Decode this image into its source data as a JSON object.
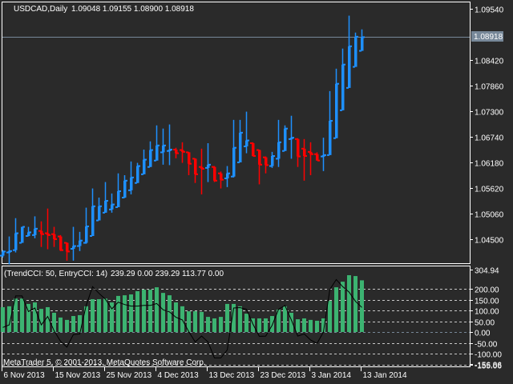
{
  "header": {
    "symbol": "USDCAD,Daily",
    "ohlc": "1.09048 1.09155 1.08900 1.08918"
  },
  "indicator": {
    "label": "(TrendCCI: 50, EntryCCI: 14)",
    "values": "239.29 0.00 239.29 113.77 0.00"
  },
  "copyright": "MetaTrader 5, © 2001-2013, MetaQuotes Software Corp.",
  "colors": {
    "background": "#2a2a2a",
    "up": "#1e90ff",
    "down": "#ff0000",
    "histogram": "#3cb371",
    "entry_line": "#000000",
    "price_line": "#778899"
  },
  "chart_data": [
    {
      "type": "ohlc",
      "title": "USDCAD,Daily",
      "current_price": "1.08918",
      "ylim": [
        1.0405,
        1.099
      ],
      "y_ticks": [
        "1.09540",
        "1.08420",
        "1.07860",
        "1.07300",
        "1.06740",
        "1.06180",
        "1.05620",
        "1.05060",
        "1.04500"
      ],
      "y_tick_values": [
        1.0954,
        1.0842,
        1.0786,
        1.073,
        1.0674,
        1.0618,
        1.0562,
        1.0506,
        1.045
      ],
      "x_labels": [
        {
          "bar": 0,
          "label": "6 Nov 2013"
        },
        {
          "bar": 8,
          "label": "15 Nov 2013"
        },
        {
          "bar": 16,
          "label": "25 Nov 2013"
        },
        {
          "bar": 24,
          "label": "4 Dec 2013"
        },
        {
          "bar": 32,
          "label": "13 Dec 2013"
        },
        {
          "bar": 40,
          "label": "23 Dec 2013"
        },
        {
          "bar": 48,
          "label": "3 Jan 2014"
        },
        {
          "bar": 56,
          "label": "13 Jan 2014"
        }
      ],
      "bars": [
        [
          1.0426,
          1.041,
          1.0423,
          1.0414,
          "u"
        ],
        [
          1.0456,
          1.0395,
          1.0424,
          1.0421,
          "u"
        ],
        [
          1.0496,
          1.0421,
          1.0463,
          1.0426,
          "u"
        ],
        [
          1.0477,
          1.0442,
          1.0477,
          1.0442,
          "u"
        ],
        [
          1.0477,
          1.0456,
          1.0465,
          1.0457,
          "u"
        ],
        [
          1.05,
          1.0452,
          1.0473,
          1.0459,
          "u"
        ],
        [
          1.0489,
          1.0433,
          1.0468,
          1.0461,
          "d"
        ],
        [
          1.0517,
          1.0428,
          1.0463,
          1.0459,
          "d"
        ],
        [
          1.0477,
          1.0433,
          1.0461,
          1.045,
          "d"
        ],
        [
          1.0459,
          1.0424,
          1.0456,
          1.0426,
          "d"
        ],
        [
          1.0443,
          1.0403,
          1.0442,
          1.0423,
          "d"
        ],
        [
          1.0477,
          1.0403,
          1.0435,
          1.0429,
          "u"
        ],
        [
          1.0466,
          1.0424,
          1.0447,
          1.0435,
          "u"
        ],
        [
          1.0519,
          1.044,
          1.0478,
          1.0442,
          "u"
        ],
        [
          1.0561,
          1.0457,
          1.0522,
          1.0457,
          "u"
        ],
        [
          1.0541,
          1.0491,
          1.0522,
          1.0491,
          "u"
        ],
        [
          1.0575,
          1.0508,
          1.0534,
          1.0508,
          "u"
        ],
        [
          1.055,
          1.0508,
          1.0526,
          1.0515,
          "u"
        ],
        [
          1.0594,
          1.052,
          1.0555,
          1.052,
          "u"
        ],
        [
          1.059,
          1.054,
          1.0578,
          1.0541,
          "u"
        ],
        [
          1.062,
          1.0548,
          1.0585,
          1.0557,
          "u"
        ],
        [
          1.0617,
          1.0573,
          1.061,
          1.0573,
          "u"
        ],
        [
          1.0646,
          1.0592,
          1.0624,
          1.0592,
          "u"
        ],
        [
          1.0664,
          1.0608,
          1.0645,
          1.0608,
          "u"
        ],
        [
          1.0699,
          1.0622,
          1.0655,
          1.0622,
          "u"
        ],
        [
          1.0692,
          1.0613,
          1.0655,
          1.064,
          "u"
        ],
        [
          1.0701,
          1.0612,
          1.0646,
          1.0643,
          "u"
        ],
        [
          1.065,
          1.0627,
          1.0646,
          1.0638,
          "d"
        ],
        [
          1.0662,
          1.0617,
          1.0645,
          1.0641,
          "d"
        ],
        [
          1.0641,
          1.059,
          1.064,
          1.0615,
          "d"
        ],
        [
          1.0627,
          1.0573,
          1.0626,
          1.0592,
          "d"
        ],
        [
          1.0648,
          1.0548,
          1.0608,
          1.0604,
          "d"
        ],
        [
          1.066,
          1.0575,
          1.0613,
          1.0606,
          "u"
        ],
        [
          1.061,
          1.0575,
          1.0608,
          1.0578,
          "d"
        ],
        [
          1.0598,
          1.0561,
          1.0594,
          1.058,
          "d"
        ],
        [
          1.061,
          1.0564,
          1.0594,
          1.0583,
          "u"
        ],
        [
          1.0711,
          1.0585,
          1.065,
          1.0587,
          "u"
        ],
        [
          1.0711,
          1.0618,
          1.0683,
          1.0618,
          "u"
        ],
        [
          1.0729,
          1.0638,
          1.0666,
          1.0653,
          "u"
        ],
        [
          1.0662,
          1.0631,
          1.066,
          1.0632,
          "d"
        ],
        [
          1.0646,
          1.057,
          1.0645,
          1.0613,
          "d"
        ],
        [
          1.0631,
          1.0594,
          1.0629,
          1.0612,
          "d"
        ],
        [
          1.0641,
          1.0606,
          1.0632,
          1.061,
          "u"
        ],
        [
          1.0711,
          1.0608,
          1.0662,
          1.0626,
          "u"
        ],
        [
          1.0699,
          1.0643,
          1.0692,
          1.0643,
          "u"
        ],
        [
          1.072,
          1.0626,
          1.0672,
          1.0669,
          "u"
        ],
        [
          1.0671,
          1.0608,
          1.0669,
          1.0631,
          "d"
        ],
        [
          1.0669,
          1.0578,
          1.0648,
          1.0632,
          "d"
        ],
        [
          1.0662,
          1.059,
          1.0641,
          1.0636,
          "d"
        ],
        [
          1.064,
          1.0622,
          1.0636,
          1.0622,
          "d"
        ],
        [
          1.0672,
          1.0599,
          1.0634,
          1.0631,
          "u"
        ],
        [
          1.0774,
          1.0634,
          1.0709,
          1.0634,
          "u"
        ],
        [
          1.0823,
          1.0671,
          1.079,
          1.0671,
          "u"
        ],
        [
          1.0867,
          1.0732,
          1.0832,
          1.0732,
          "u"
        ],
        [
          1.0939,
          1.0781,
          1.0872,
          1.0781,
          "u"
        ],
        [
          1.0902,
          1.0827,
          1.0893,
          1.0827,
          "u"
        ],
        [
          1.0909,
          1.0862,
          1.0892,
          1.0862,
          "u"
        ]
      ],
      "bar_fields": [
        "high",
        "low",
        "body_top",
        "body_bottom",
        "direction"
      ]
    },
    {
      "type": "bar+line",
      "title": "(TrendCCI: 50, EntryCCI: 14)",
      "ylim": [
        -157,
        305
      ],
      "y_ticks": [
        "304.94",
        "200.00",
        "150.00",
        "100.00",
        "50.00",
        "0.00",
        "-50.00",
        "-100.00",
        "-155.06",
        "-156.86"
      ],
      "y_tick_values": [
        304.94,
        200,
        150,
        100,
        50,
        0,
        -50,
        -100,
        -155.06,
        -156.86
      ],
      "grid_levels": [
        200,
        150,
        100,
        50,
        -50,
        -100,
        -150
      ],
      "series": [
        {
          "name": "TrendCCI",
          "type": "bar",
          "values": [
            115,
            119,
            155,
            155,
            130,
            137,
            107,
            115,
            89,
            67,
            56,
            74,
            78,
            119,
            152,
            152,
            155,
            137,
            167,
            170,
            174,
            189,
            196,
            196,
            207,
            181,
            170,
            137,
            119,
            96,
            96,
            93,
            70,
            63,
            70,
            130,
            130,
            119,
            85,
            63,
            63,
            63,
            74,
            104,
            119,
            89,
            59,
            63,
            56,
            52,
            63,
            144,
            207,
            233,
            263,
            259,
            239.29
          ]
        },
        {
          "name": "EntryCCI",
          "type": "line",
          "values": [
            21,
            33,
            167,
            167,
            95,
            111,
            33,
            72,
            6,
            -43,
            -70,
            -12,
            -9,
            123,
            210,
            179,
            152,
            107,
            138,
            127,
            120,
            120,
            123,
            123,
            132,
            103,
            93,
            68,
            56,
            2,
            -46,
            -19,
            -46,
            -120,
            -120,
            -83,
            111,
            113,
            105,
            37,
            -20,
            -19,
            31,
            105,
            123,
            56,
            -19,
            -9,
            -37,
            -53,
            0,
            197,
            243,
            210,
            185,
            142,
            113.77
          ]
        }
      ]
    }
  ]
}
